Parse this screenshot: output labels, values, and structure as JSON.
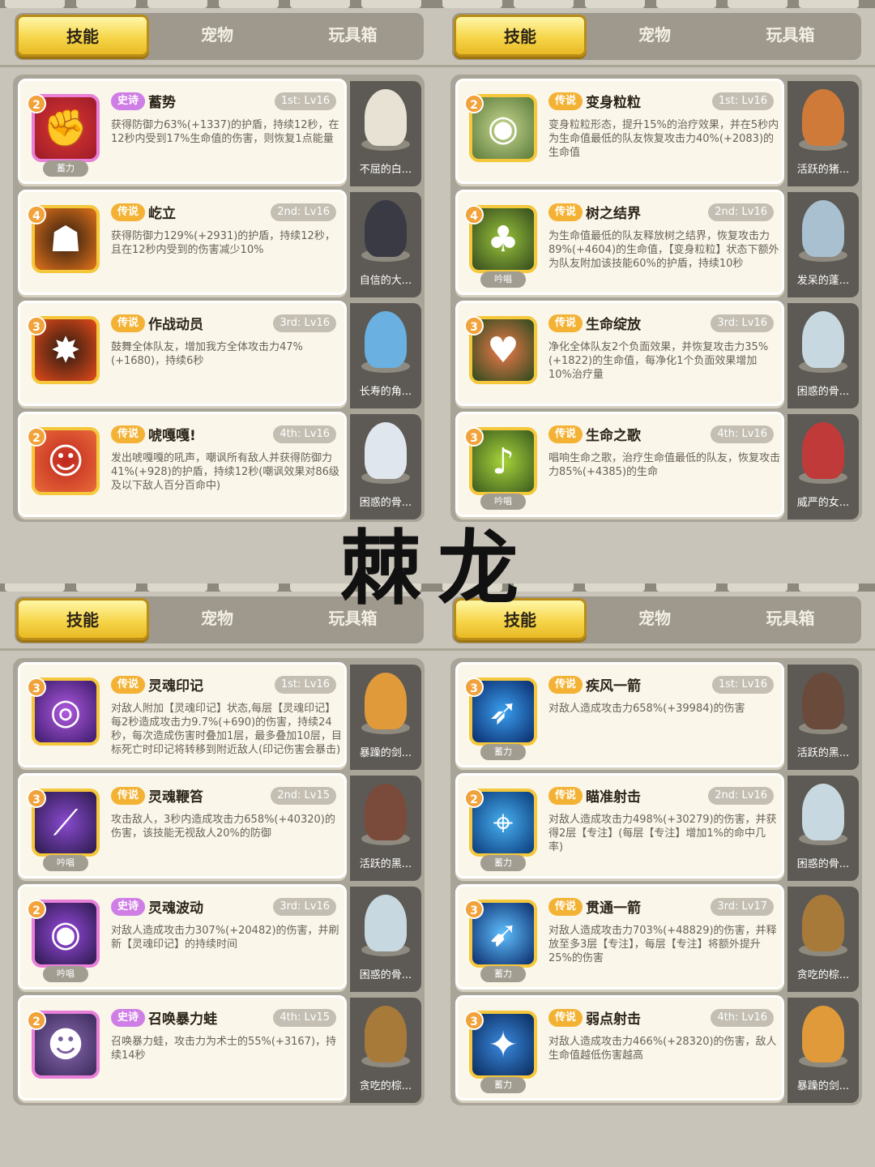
{
  "overlay_title": "棘龙",
  "tabs": [
    "技能",
    "宠物",
    "玩具箱"
  ],
  "panels": [
    {
      "cards": [
        {
          "level": "2",
          "rarity": "史诗",
          "rarity_type": "epic",
          "name": "蓄势",
          "slot": "1st: Lv16",
          "desc": "获得防御力63%(+1337)的护盾，持续12秒，在12秒内受到17%生命值的伤害，则恢复1点能量",
          "tag": "蓄力",
          "pet": "不屈的白...",
          "icon": "fist-icon"
        },
        {
          "level": "4",
          "rarity": "传说",
          "rarity_type": "legend",
          "name": "屹立",
          "slot": "2nd: Lv16",
          "desc": "获得防御力129%(+2931)的护盾，持续12秒，且在12秒内受到的伤害减少10%",
          "tag": "",
          "pet": "自信的大...",
          "icon": "silhouette-icon"
        },
        {
          "level": "3",
          "rarity": "传说",
          "rarity_type": "legend",
          "name": "作战动员",
          "slot": "3rd: Lv16",
          "desc": "鼓舞全体队友，增加我方全体攻击力47%(+1680)，持续6秒",
          "tag": "",
          "pet": "长寿的角...",
          "icon": "rally-icon"
        },
        {
          "level": "2",
          "rarity": "传说",
          "rarity_type": "legend",
          "name": "唬嘎嘎!",
          "slot": "4th: Lv16",
          "desc": "发出唬嘎嘎的吼声，嘲讽所有敌人并获得防御力41%(+928)的护盾，持续12秒(嘲讽效果对86级及以下敌人百分百命中)",
          "tag": "",
          "pet": "困惑的骨...",
          "icon": "roar-icon"
        }
      ]
    },
    {
      "cards": [
        {
          "level": "2",
          "rarity": "传说",
          "rarity_type": "legend",
          "name": "变身粒粒",
          "slot": "1st: Lv16",
          "desc": "变身粒粒形态，提升15%的治疗效果，并在5秒内为生命值最低的队友恢复攻击力40%(+2083)的生命值",
          "tag": "",
          "pet": "活跃的猪...",
          "icon": "owl-icon"
        },
        {
          "level": "4",
          "rarity": "传说",
          "rarity_type": "legend",
          "name": "树之结界",
          "slot": "2nd: Lv16",
          "desc": "为生命值最低的队友释放树之结界，恢复攻击力89%(+4604)的生命值，【变身粒粒】状态下额外为队友附加该技能60%的护盾，持续10秒",
          "tag": "吟唱",
          "pet": "发呆的蓬...",
          "icon": "tree-icon"
        },
        {
          "level": "3",
          "rarity": "传说",
          "rarity_type": "legend",
          "name": "生命绽放",
          "slot": "3rd: Lv16",
          "desc": "净化全体队友2个负面效果，并恢复攻击力35%(+1822)的生命值，每净化1个负面效果增加10%治疗量",
          "tag": "",
          "pet": "困惑的骨...",
          "icon": "heart-icon"
        },
        {
          "level": "3",
          "rarity": "传说",
          "rarity_type": "legend",
          "name": "生命之歌",
          "slot": "4th: Lv16",
          "desc": "唱响生命之歌，治疗生命值最低的队友，恢复攻击力85%(+4385)的生命",
          "tag": "吟唱",
          "pet": "威严的女...",
          "icon": "song-icon"
        }
      ]
    },
    {
      "cards": [
        {
          "level": "3",
          "rarity": "传说",
          "rarity_type": "legend",
          "name": "灵魂印记",
          "slot": "1st: Lv16",
          "desc": "对敌人附加【灵魂印记】状态,每层【灵魂印记】每2秒造成攻击力9.7%(+690)的伤害，持续24秒，每次造成伤害时叠加1层，最多叠加10层，目标死亡时印记将转移到附近敌人(印记伤害会暴击)",
          "tag": "",
          "pet": "暴躁的剑...",
          "icon": "soul-icon"
        },
        {
          "level": "3",
          "rarity": "传说",
          "rarity_type": "legend",
          "name": "灵魂鞭笞",
          "slot": "2nd: Lv15",
          "desc": "攻击敌人，3秒内造成攻击力658%(+40320)的伤害，该技能无视敌人20%的防御",
          "tag": "吟唱",
          "pet": "活跃的黑...",
          "icon": "whip-icon"
        },
        {
          "level": "2",
          "rarity": "史诗",
          "rarity_type": "epic",
          "name": "灵魂波动",
          "slot": "3rd: Lv16",
          "desc": "对敌人造成攻击力307%(+20482)的伤害，并刷新【灵魂印记】的持续时间",
          "tag": "吟唱",
          "pet": "困惑的骨...",
          "icon": "vortex-icon"
        },
        {
          "level": "2",
          "rarity": "史诗",
          "rarity_type": "epic",
          "name": "召唤暴力蛙",
          "slot": "4th: Lv15",
          "desc": "召唤暴力蛙，攻击力为术士的55%(+3167)，持续14秒",
          "tag": "",
          "pet": "贪吃的棕...",
          "icon": "frog-icon"
        }
      ]
    },
    {
      "cards": [
        {
          "level": "3",
          "rarity": "传说",
          "rarity_type": "legend",
          "name": "疾风一箭",
          "slot": "1st: Lv16",
          "desc": "对敌人造成攻击力658%(+39984)的伤害",
          "tag": "蓄力",
          "pet": "活跃的黑...",
          "icon": "arrow-icon"
        },
        {
          "level": "2",
          "rarity": "传说",
          "rarity_type": "legend",
          "name": "瞄准射击",
          "slot": "2nd: Lv16",
          "desc": "对敌人造成攻击力498%(+30279)的伤害，并获得2层【专注】(每层【专注】增加1%的命中几率)",
          "tag": "蓄力",
          "pet": "困惑的骨...",
          "icon": "target-icon"
        },
        {
          "level": "3",
          "rarity": "传说",
          "rarity_type": "legend",
          "name": "贯通一箭",
          "slot": "3rd: Lv17",
          "desc": "对敌人造成攻击力703%(+48829)的伤害，并释放至多3层【专注】，每层【专注】将额外提升25%的伤害",
          "tag": "蓄力",
          "pet": "贪吃的棕...",
          "icon": "pierce-icon"
        },
        {
          "level": "3",
          "rarity": "传说",
          "rarity_type": "legend",
          "name": "弱点射击",
          "slot": "4th: Lv16",
          "desc": "对敌人造成攻击力466%(+28320)的伤害，敌人生命值越低伤害越高",
          "tag": "蓄力",
          "pet": "暴躁的剑...",
          "icon": "burst-icon"
        }
      ]
    }
  ]
}
